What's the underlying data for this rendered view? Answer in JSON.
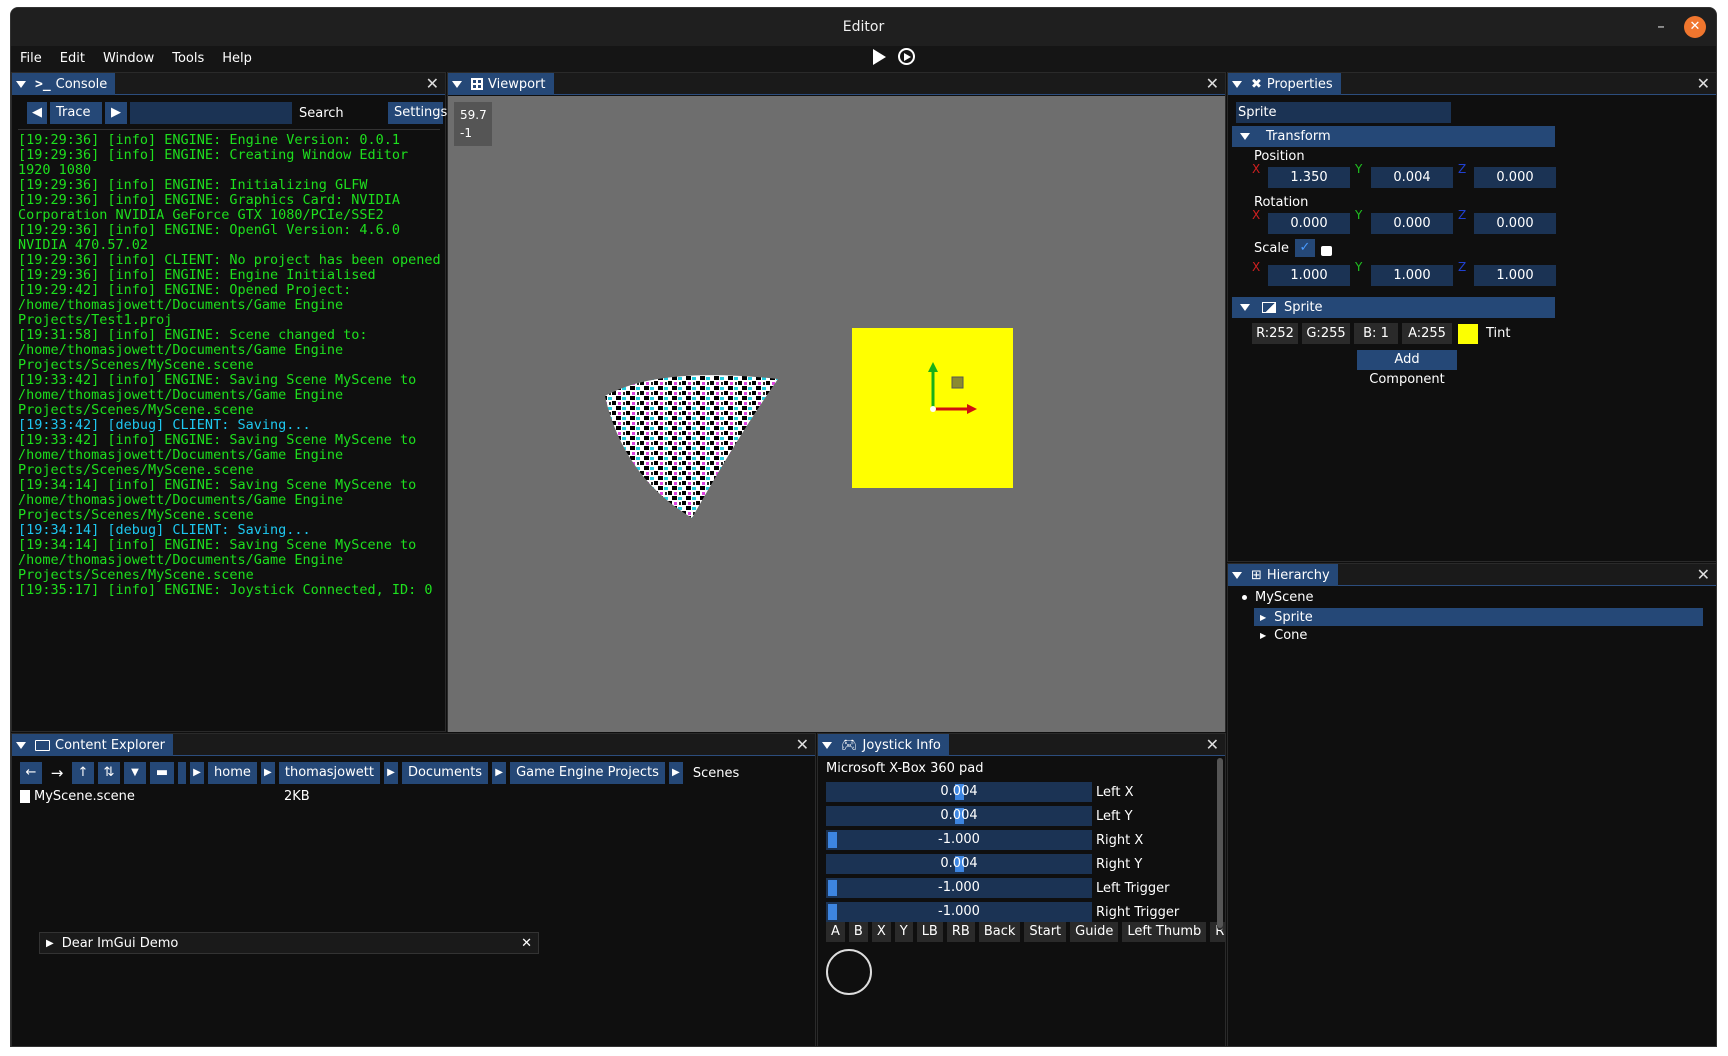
{
  "window": {
    "title": "Editor",
    "min": "–",
    "close": "✕"
  },
  "menu": [
    "File",
    "Edit",
    "Window",
    "Tools",
    "Help"
  ],
  "console": {
    "title": "Console",
    "level": "Trace",
    "search_label": "Search",
    "settings": "Settings",
    "lines": [
      {
        "t": "[19:29:36] [info] ENGINE: Engine Version: 0.0.1",
        "c": "#1ee01e"
      },
      {
        "t": "[19:29:36] [info] ENGINE: Creating Window Editor 1920 1080",
        "c": "#1ee01e"
      },
      {
        "t": "[19:29:36] [info] ENGINE: Initializing GLFW",
        "c": "#1ee01e"
      },
      {
        "t": "[19:29:36] [info] ENGINE: Graphics Card: NVIDIA Corporation NVIDIA GeForce GTX 1080/PCIe/SSE2",
        "c": "#1ee01e"
      },
      {
        "t": "[19:29:36] [info] ENGINE: OpenGl Version: 4.6.0 NVIDIA 470.57.02",
        "c": "#1ee01e"
      },
      {
        "t": "[19:29:36] [info] CLIENT: No project has been opened",
        "c": "#1ee01e"
      },
      {
        "t": "[19:29:36] [info] ENGINE: Engine Initialised",
        "c": "#1ee01e"
      },
      {
        "t": "[19:29:42] [info] ENGINE: Opened Project: /home/thomasjowett/Documents/Game Engine Projects/Test1.proj",
        "c": "#1ee01e"
      },
      {
        "t": "[19:31:58] [info] ENGINE: Scene changed to: /home/thomasjowett/Documents/Game Engine Projects/Scenes/MyScene.scene",
        "c": "#1ee01e"
      },
      {
        "t": "[19:33:42] [info] ENGINE: Saving Scene MyScene to /home/thomasjowett/Documents/Game Engine Projects/Scenes/MyScene.scene",
        "c": "#1ee01e"
      },
      {
        "t": "[19:33:42] [debug] CLIENT: Saving...",
        "c": "#1ec8f0"
      },
      {
        "t": "[19:33:42] [info] ENGINE: Saving Scene MyScene to /home/thomasjowett/Documents/Game Engine Projects/Scenes/MyScene.scene",
        "c": "#1ee01e"
      },
      {
        "t": "[19:34:14] [info] ENGINE: Saving Scene MyScene to /home/thomasjowett/Documents/Game Engine Projects/Scenes/MyScene.scene",
        "c": "#1ee01e"
      },
      {
        "t": "[19:34:14] [debug] CLIENT: Saving...",
        "c": "#1ec8f0"
      },
      {
        "t": "[19:34:14] [info] ENGINE: Saving Scene MyScene to /home/thomasjowett/Documents/Game Engine Projects/Scenes/MyScene.scene",
        "c": "#1ee01e"
      },
      {
        "t": "[19:35:17] [info] ENGINE: Joystick Connected, ID: 0",
        "c": "#1ee01e"
      }
    ]
  },
  "viewport": {
    "title": "Viewport",
    "fps": "59.7",
    "id": "-1",
    "sprite_color": "#ffff00",
    "bg": "#6e6e6e"
  },
  "properties": {
    "title": "Properties",
    "name": "Sprite",
    "transform": "Transform",
    "position_label": "Position",
    "position": [
      "1.350",
      "0.004",
      "0.000"
    ],
    "rotation_label": "Rotation",
    "rotation": [
      "0.000",
      "0.000",
      "0.000"
    ],
    "scale_label": "Scale",
    "scale": [
      "1.000",
      "1.000",
      "1.000"
    ],
    "axes": [
      "X",
      "Y",
      "Z"
    ],
    "sprite_section": "Sprite",
    "tint": [
      "R:252",
      "G:255",
      "B:  1",
      "A:255"
    ],
    "tint_label": "Tint",
    "tint_color": "#fcff01",
    "add_component": "Add Component"
  },
  "hierarchy": {
    "title": "Hierarchy",
    "root": "MyScene",
    "children": [
      "Sprite",
      "Cone"
    ]
  },
  "content": {
    "title": "Content Explorer",
    "crumbs": [
      "home",
      "thomasjowett",
      "Documents",
      "Game Engine Projects",
      "Scenes"
    ],
    "files": [
      {
        "name": "MyScene.scene",
        "size": "2KB"
      }
    ],
    "demo": "Dear ImGui Demo"
  },
  "joystick": {
    "title": "Joystick Info",
    "device": "Microsoft X-Box 360 pad",
    "axes": [
      {
        "value": "0.004",
        "label": "Left X",
        "frac": 0.502
      },
      {
        "value": "0.004",
        "label": "Left Y",
        "frac": 0.502
      },
      {
        "value": "-1.000",
        "label": "Right X",
        "frac": 0
      },
      {
        "value": "0.004",
        "label": "Right Y",
        "frac": 0.502
      },
      {
        "value": "-1.000",
        "label": "Left Trigger",
        "frac": 0
      },
      {
        "value": "-1.000",
        "label": "Right Trigger",
        "frac": 0
      }
    ],
    "buttons": [
      "A",
      "B",
      "X",
      "Y",
      "LB",
      "RB",
      "Back",
      "Start",
      "Guide",
      "Left Thumb",
      "Righ"
    ]
  }
}
